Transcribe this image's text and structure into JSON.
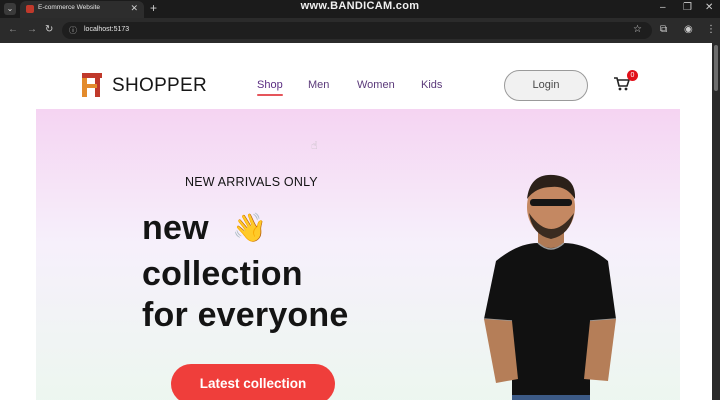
{
  "browser": {
    "tab_title": "E-commerce Website",
    "address": "localhost:5173",
    "watermark": "www.BANDICAM.com"
  },
  "navbar": {
    "brand": "SHOPPER",
    "menu": [
      {
        "label": "Shop",
        "active": true
      },
      {
        "label": "Men",
        "active": false
      },
      {
        "label": "Women",
        "active": false
      },
      {
        "label": "Kids",
        "active": false
      }
    ],
    "login_label": "Login",
    "cart_count": "0"
  },
  "hero": {
    "kicker": "NEW ARRIVALS ONLY",
    "line1": "new",
    "line2": "collection",
    "line3": "for everyone",
    "cta_label": "Latest collection",
    "hand_icon": "👋"
  },
  "colors": {
    "accent": "#ef3e3b",
    "menu_text": "#5b3a7a",
    "hero_top": "#f5d4f2",
    "hero_bottom": "#ecf7ef"
  },
  "icons": {
    "tab_menu": "chevron-down-icon",
    "cart": "cart-icon",
    "hand": "waving-hand-icon",
    "cursor": "hand-pointer-icon"
  }
}
